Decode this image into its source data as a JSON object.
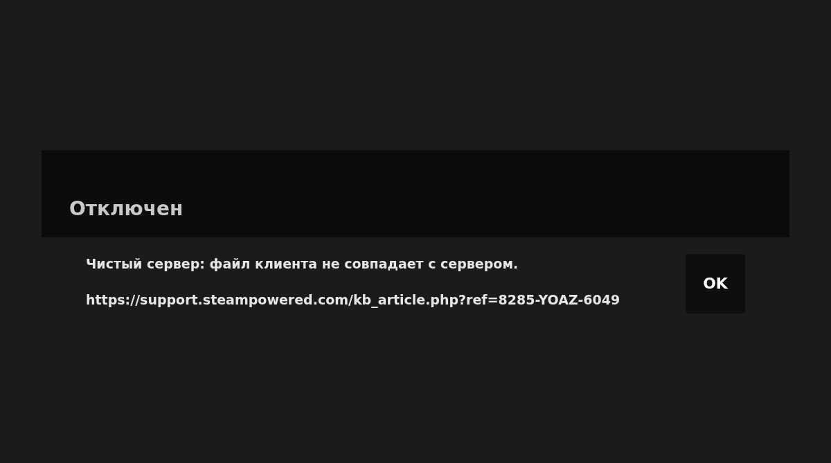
{
  "dialog": {
    "title": "Отключен",
    "message": "Чистый сервер: файл клиента не совпадает с сервером.",
    "link": "https://support.steampowered.com/kb_article.php?ref=8285-YOAZ-6049",
    "buttons": [
      {
        "label": "OK"
      }
    ]
  }
}
